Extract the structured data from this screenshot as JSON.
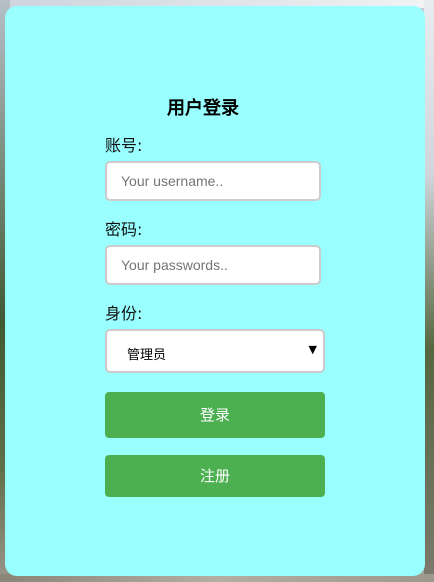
{
  "login": {
    "title": "用户登录",
    "account_label": "账号:",
    "account_placeholder": "Your username..",
    "password_label": "密码:",
    "password_placeholder": "Your passwords..",
    "role_label": "身份:",
    "role_selected": "管理员",
    "login_button": "登录",
    "register_button": "注册"
  },
  "icons": {
    "select_arrow": "chevron-down-icon"
  },
  "colors": {
    "card_background": "#99ffff",
    "button_green": "#4caf50",
    "input_border": "#cccccc"
  }
}
